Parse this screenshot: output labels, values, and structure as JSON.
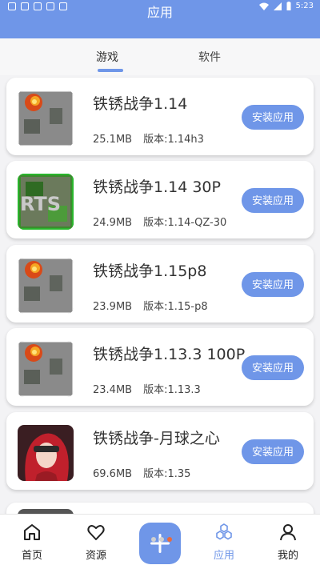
{
  "status_bar": {
    "time": "5:23"
  },
  "header": {
    "title": "应用"
  },
  "tabs": [
    {
      "label": "游戏",
      "active": true
    },
    {
      "label": "软件",
      "active": false
    }
  ],
  "apps": [
    {
      "name": "铁锈战争1.14",
      "size": "25.1MB",
      "version": "版本:1.14h3",
      "button": "安装应用",
      "icon": "rusted-warfare-icon"
    },
    {
      "name": "铁锈战争1.14 30P",
      "size": "24.9MB",
      "version": "版本:1.14-QZ-30",
      "button": "安装应用",
      "icon": "rts-map-icon"
    },
    {
      "name": "铁锈战争1.15p8",
      "size": "23.9MB",
      "version": "版本:1.15-p8",
      "button": "安装应用",
      "icon": "rusted-warfare-icon"
    },
    {
      "name": "铁锈战争1.13.3 100P",
      "size": "23.4MB",
      "version": "版本:1.13.3",
      "button": "安装应用",
      "icon": "rusted-warfare-icon"
    },
    {
      "name": "铁锈战争-月球之心",
      "size": "69.6MB",
      "version": "版本:1.35",
      "button": "安装应用",
      "icon": "anime-girl-icon"
    }
  ],
  "bottom_nav": {
    "home": "首页",
    "resource": "资源",
    "app": "应用",
    "mine": "我的"
  },
  "colors": {
    "accent": "#6f96e8",
    "indicator": "#e96a3b"
  }
}
